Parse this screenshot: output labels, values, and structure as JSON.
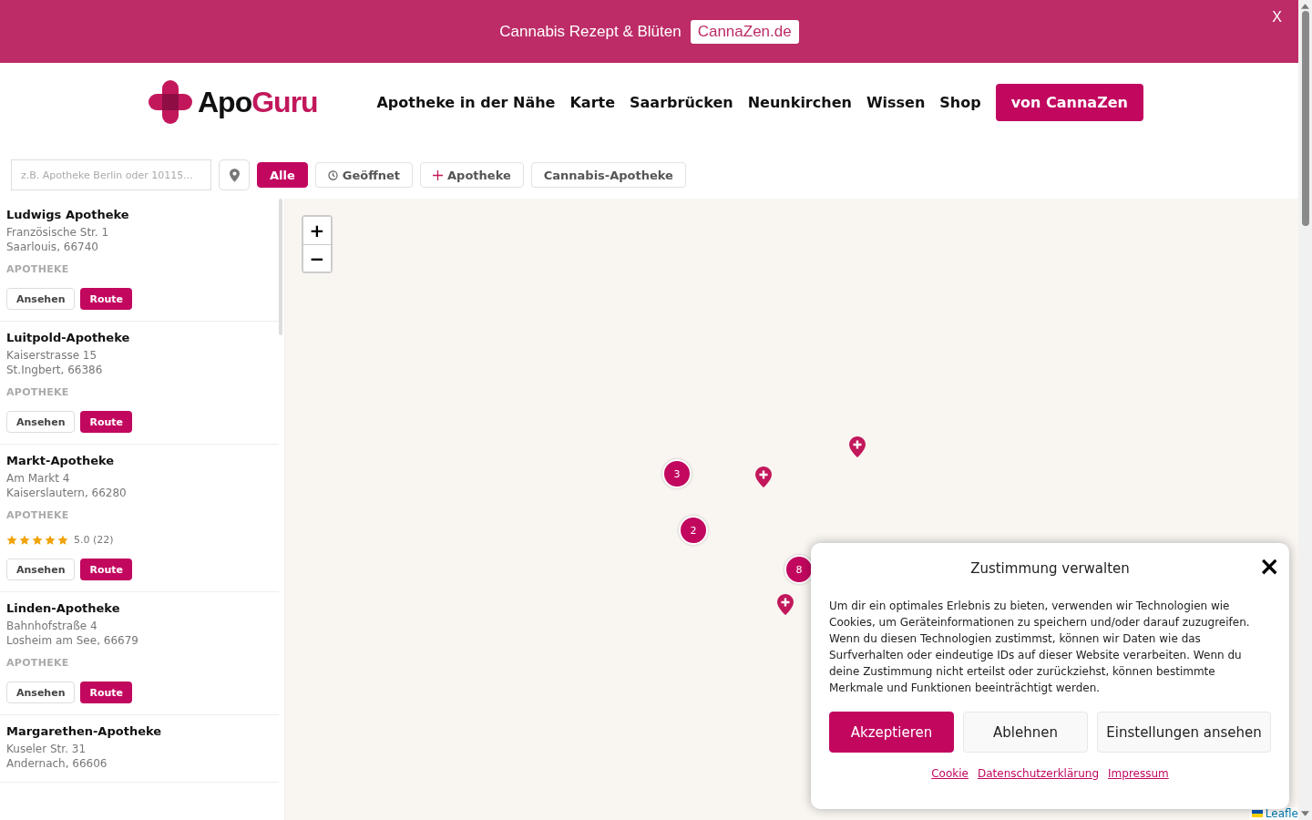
{
  "banner": {
    "text": "Cannabis Rezept & Blüten",
    "link": "CannaZen.de",
    "close": "X"
  },
  "header": {
    "logo_parts": [
      "Apo",
      "Guru"
    ],
    "nav": [
      "Apotheke in der Nähe",
      "Karte",
      "Saarbrücken",
      "Neunkirchen",
      "Wissen",
      "Shop"
    ],
    "cta": "von CannaZen"
  },
  "filters": {
    "search": {
      "placeholder": "z.B. Apotheke Berlin oder 10115..."
    },
    "chips": [
      {
        "label": "Alle",
        "kind": "plain",
        "selected": true
      },
      {
        "label": "Geöffnet",
        "kind": "clock",
        "selected": false
      },
      {
        "label": "Apotheke",
        "kind": "plus",
        "selected": false
      },
      {
        "label": "Cannabis-Apotheke",
        "kind": "plain",
        "selected": false
      }
    ]
  },
  "pharmacies": [
    {
      "name": "Ludwigs Apotheke",
      "street": "Französische Str. 1",
      "city": "Saarlouis, 66740",
      "type": "APOTHEKE",
      "buttons": [
        "Ansehen",
        "Route"
      ]
    },
    {
      "name": "Luitpold-Apotheke",
      "street": "Kaiserstrasse 15",
      "city": "St.Ingbert, 66386",
      "type": "APOTHEKE",
      "buttons": [
        "Ansehen",
        "Route"
      ]
    },
    {
      "name": "Markt-Apotheke",
      "street": "Am Markt 4",
      "city": "Kaiserslautern, 66280",
      "type": "APOTHEKE",
      "stars": 5,
      "rating": "5.0 (22)",
      "buttons": [
        "Ansehen",
        "Route"
      ]
    },
    {
      "name": "Linden-Apotheke",
      "street": "Bahnhofstraße 4",
      "city": "Losheim am See, 66679",
      "type": "APOTHEKE",
      "buttons": [
        "Ansehen",
        "Route"
      ]
    },
    {
      "name": "Margarethen-Apotheke",
      "street": "Kuseler Str. 31",
      "city": "Andernach, 66606"
    }
  ],
  "map": {
    "zoom": [
      "+",
      "−"
    ],
    "clusters": [
      "3",
      "2",
      "8"
    ],
    "attribution": "Leafle"
  },
  "consent": {
    "title": "Zustimmung verwalten",
    "close": "×",
    "text": "Um dir ein optimales Erlebnis zu bieten, verwenden wir Technologien wie Cookies, um Geräteinformationen zu speichern und/oder darauf zuzugreifen. Wenn du diesen Technologien zustimmst, können wir Daten wie das Surfverhalten oder eindeutige IDs auf dieser Website verarbeiten. Wenn du deine Zustimmung nicht erteilst oder zurückziehst, können bestimmte Merkmale und Funktionen beeinträchtigt werden.",
    "buttons": [
      {
        "label": "Akzeptieren",
        "kind": "primary"
      },
      {
        "label": "Ablehnen",
        "kind": "secondary"
      },
      {
        "label": "Einstellungen ansehen",
        "kind": "secondary"
      }
    ],
    "links": [
      "Cookie",
      "Datenschutzerklärung",
      "Impressum"
    ]
  }
}
